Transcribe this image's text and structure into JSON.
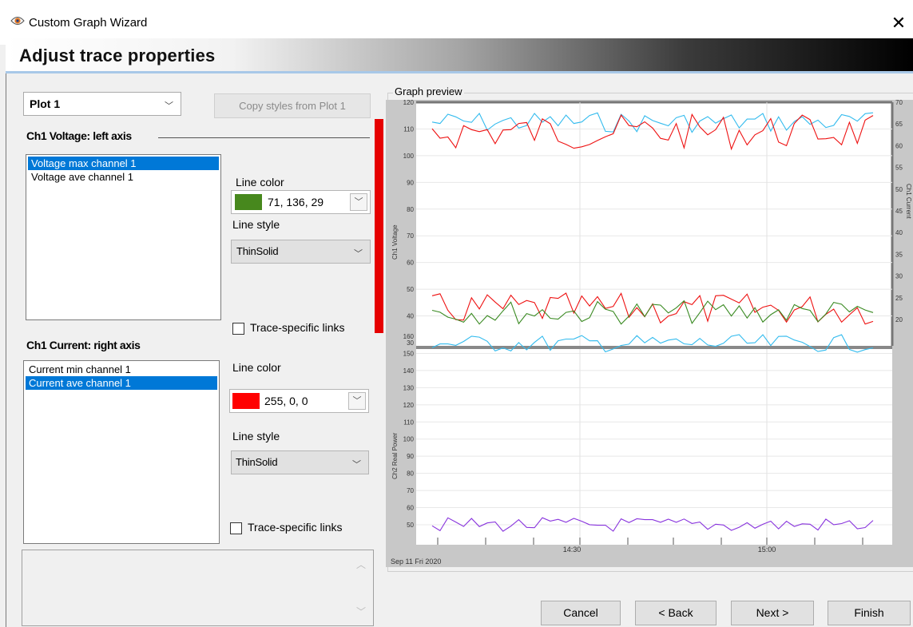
{
  "window": {
    "title": "Custom Graph Wizard",
    "close_glyph": "✕",
    "icon": "eye-icon"
  },
  "header": {
    "title": "Adjust trace properties"
  },
  "plot_select": {
    "value": "Plot 1",
    "arrow": "﹀"
  },
  "copy_styles_label": "Copy styles from Plot 1",
  "voltage_section": {
    "heading": "Ch1 Voltage: left axis",
    "traces": [
      {
        "label": "Voltage max channel 1",
        "selected": true
      },
      {
        "label": "Voltage ave channel 1",
        "selected": false
      }
    ],
    "line_color_label": "Line color",
    "line_color": {
      "value": "71, 136, 29",
      "hex": "#47881d"
    },
    "line_style_label": "Line style",
    "line_style": "ThinSolid",
    "links_label": "Trace-specific links"
  },
  "current_section": {
    "heading": "Ch1 Current: right axis",
    "traces": [
      {
        "label": "Current min channel 1",
        "selected": false
      },
      {
        "label": "Current ave channel 1",
        "selected": true
      }
    ],
    "line_color_label": "Line color",
    "line_color": {
      "value": "255, 0, 0",
      "hex": "#ff0000"
    },
    "line_style_label": "Line style",
    "line_style": "ThinSolid",
    "links_label": "Trace-specific links"
  },
  "graph": {
    "legend": "Graph preview",
    "date_label": "Sep 11 Fri 2020",
    "x_ticks": [
      "14:30",
      "15:00"
    ],
    "top_left_axis": {
      "label": "Ch1 Voltage",
      "ticks": [
        "120",
        "110",
        "100",
        "90",
        "80",
        "70",
        "60",
        "50",
        "40",
        "30"
      ]
    },
    "top_right_axis": {
      "label": "Ch1 Current",
      "ticks": [
        "70",
        "65",
        "60",
        "55",
        "50",
        "45",
        "40",
        "35",
        "30",
        "25",
        "20"
      ]
    },
    "bottom_left_axis": {
      "label": "Ch2 Real Power",
      "ticks": [
        "160",
        "150",
        "140",
        "130",
        "120",
        "110",
        "100",
        "90",
        "80",
        "70",
        "60",
        "50"
      ]
    },
    "colors": {
      "cyan": "#33bbee",
      "red": "#ee1111",
      "green": "#3a8a22",
      "purple": "#8833dd"
    }
  },
  "buttons": {
    "cancel": "Cancel",
    "back": "< Back",
    "next": "Next >",
    "finish": "Finish"
  }
}
